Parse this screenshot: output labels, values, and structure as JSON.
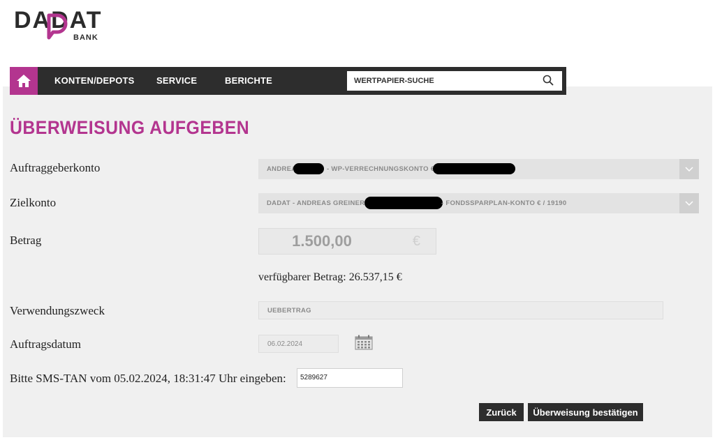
{
  "brand": {
    "name": "DADAT",
    "sub": "BANK",
    "accent": "#b3358f",
    "dark": "#2d2d2d"
  },
  "nav": {
    "home_icon": "home-icon",
    "items": [
      "KONTEN/DEPOTS",
      "SERVICE",
      "BERICHTE"
    ],
    "search_placeholder": "WERTPAPIER-SUCHE",
    "search_icon": "search-icon"
  },
  "page": {
    "title": "ÜBERWEISUNG AUFGEBEN"
  },
  "form": {
    "auftraggeber": {
      "label": "Auftraggeberkonto",
      "text_a": "ANDREAS",
      "text_b": "- WP-VERRECHNUNGSKONTO € - A"
    },
    "zielkonto": {
      "label": "Zielkonto",
      "text_a": "DADAT - ANDREAS GREINER - AT",
      "text_b": "- FONDSSPARPLAN-KONTO € / 19190"
    },
    "betrag": {
      "label": "Betrag",
      "value": "1.500,00",
      "currency": "€"
    },
    "available": "verfügbarer Betrag: 26.537,15 €",
    "verwendungszweck": {
      "label": "Verwendungszweck",
      "value": "UEBERTRAG"
    },
    "auftragsdatum": {
      "label": "Auftragsdatum",
      "value": "06.02.2024",
      "icon": "calendar-icon"
    },
    "tan": {
      "label": "Bitte SMS-TAN vom 05.02.2024, 18:31:47 Uhr eingeben:",
      "value": "5289627"
    }
  },
  "buttons": {
    "back": "Zurück",
    "confirm": "Überweisung bestätigen"
  }
}
